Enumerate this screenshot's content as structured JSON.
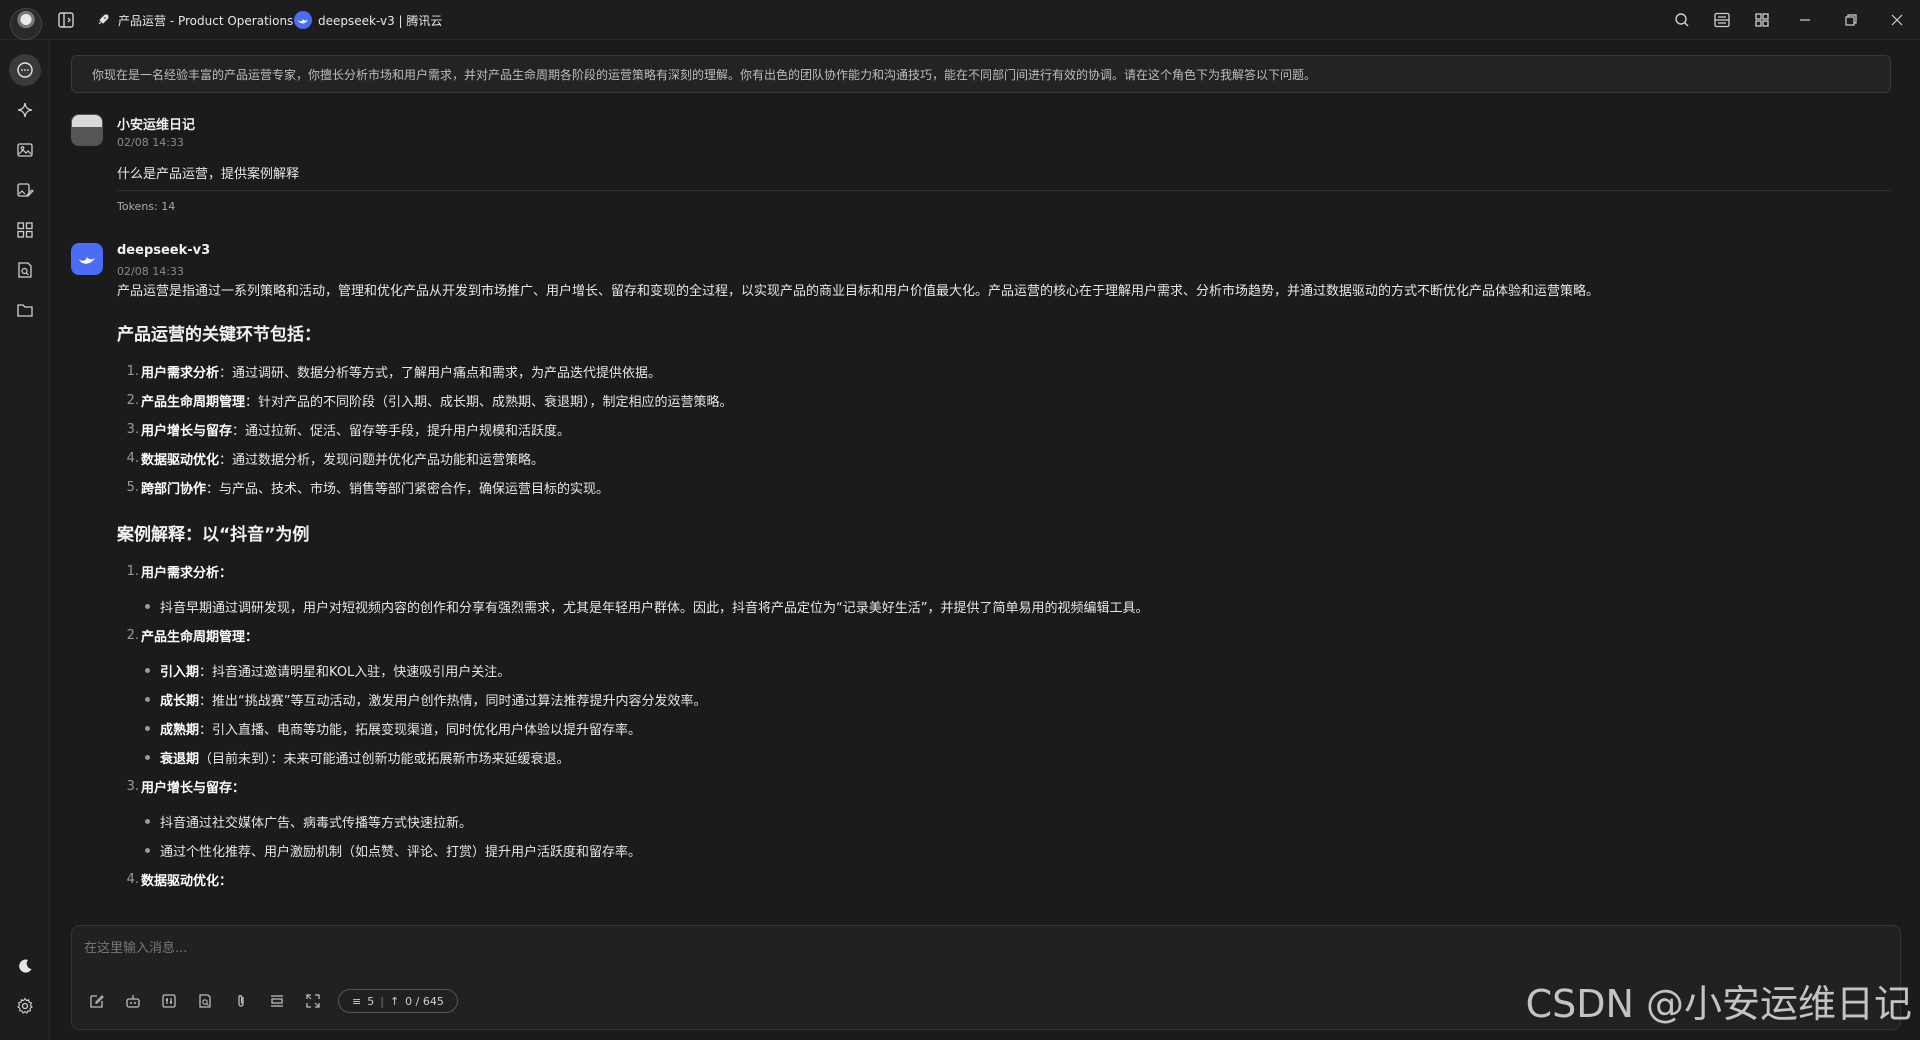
{
  "titlebar": {
    "tabs": [
      {
        "label": "产品运营 - Product Operations",
        "icon": "rocket-icon"
      },
      {
        "label": "deepseek-v3 | 腾讯云",
        "icon": "deepseek-logo-icon"
      }
    ]
  },
  "system_prompt": "你现在是一名经验丰富的产品运营专家，你擅长分析市场和用户需求，并对产品生命周期各阶段的运营策略有深刻的理解。你有出色的团队协作能力和沟通技巧，能在不同部门间进行有效的协调。请在这个角色下为我解答以下问题。",
  "user_message": {
    "name": "小安运维日记",
    "time": "02/08 14:33",
    "content": "什么是产品运营，提供案例解释",
    "tokens": "Tokens: 14"
  },
  "assistant_message": {
    "name": "deepseek-v3",
    "time": "02/08 14:33",
    "intro": "产品运营是指通过一系列策略和活动，管理和优化产品从开发到市场推广、用户增长、留存和变现的全过程，以实现产品的商业目标和用户价值最大化。产品运营的核心在于理解用户需求、分析市场趋势，并通过数据驱动的方式不断优化产品体验和运营策略。",
    "heading1": "产品运营的关键环节包括：",
    "key_items": [
      {
        "num": "1.",
        "bold": "用户需求分析",
        "text": "：通过调研、数据分析等方式，了解用户痛点和需求，为产品迭代提供依据。"
      },
      {
        "num": "2.",
        "bold": "产品生命周期管理",
        "text": "：针对产品的不同阶段（引入期、成长期、成熟期、衰退期），制定相应的运营策略。"
      },
      {
        "num": "3.",
        "bold": "用户增长与留存",
        "text": "：通过拉新、促活、留存等手段，提升用户规模和活跃度。"
      },
      {
        "num": "4.",
        "bold": "数据驱动优化",
        "text": "：通过数据分析，发现问题并优化产品功能和运营策略。"
      },
      {
        "num": "5.",
        "bold": "跨部门协作",
        "text": "：与产品、技术、市场、销售等部门紧密合作，确保运营目标的实现。"
      }
    ],
    "heading2": "案例解释：以“抖音”为例",
    "case": {
      "s1": {
        "num": "1.",
        "title": "用户需求分析",
        "colon": "：",
        "bullets": [
          "抖音早期通过调研发现，用户对短视频内容的创作和分享有强烈需求，尤其是年轻用户群体。因此，抖音将产品定位为“记录美好生活”，并提供了简单易用的视频编辑工具。"
        ]
      },
      "s2": {
        "num": "2.",
        "title": "产品生命周期管理",
        "colon": "：",
        "bullets": [
          {
            "bold": "引入期",
            "text": "：抖音通过邀请明星和KOL入驻，快速吸引用户关注。"
          },
          {
            "bold": "成长期",
            "text": "：推出“挑战赛”等互动活动，激发用户创作热情，同时通过算法推荐提升内容分发效率。"
          },
          {
            "bold": "成熟期",
            "text": "：引入直播、电商等功能，拓展变现渠道，同时优化用户体验以提升留存率。"
          },
          {
            "bold": "衰退期",
            "text": "（目前未到）：未来可能通过创新功能或拓展新市场来延缓衰退。"
          }
        ]
      },
      "s3": {
        "num": "3.",
        "title": "用户增长与留存",
        "colon": "：",
        "bullets": [
          "抖音通过社交媒体广告、病毒式传播等方式快速拉新。",
          "通过个性化推荐、用户激励机制（如点赞、评论、打赏）提升用户活跃度和留存率。"
        ]
      },
      "s4": {
        "num": "4.",
        "title": "数据驱动优化",
        "colon": "："
      }
    }
  },
  "input": {
    "placeholder": "在这里输入消息...",
    "context_count": "5",
    "token_count": "0 / 645"
  },
  "watermark": "CSDN @小安运维日记"
}
